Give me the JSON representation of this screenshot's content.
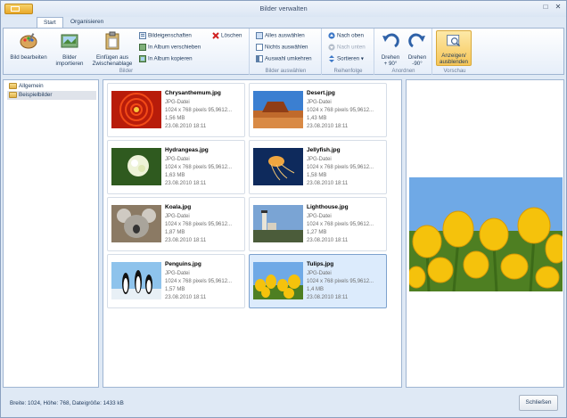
{
  "window": {
    "title": "Bilder verwalten"
  },
  "tabs": [
    "Start",
    "Organisieren"
  ],
  "ribbon": {
    "bilder": {
      "label": "Bilder",
      "bearbeiten": "Bild bearbeiten",
      "importieren_1": "Bilder",
      "importieren_2": "importieren",
      "einfuegen_1": "Einfügen aus",
      "einfuegen_2": "Zwischenablage",
      "eigenschaften": "Bildeigenschaften",
      "verschieben": "In Album verschieben",
      "kopieren": "In Album kopieren",
      "loeschen": "Löschen"
    },
    "auswahl": {
      "label": "Bilder auswählen",
      "alle": "Alles auswählen",
      "nichts": "Nichts auswählen",
      "umkehren": "Auswahl umkehren"
    },
    "reihenfolge": {
      "label": "Reihenfolge",
      "oben": "Nach oben",
      "unten": "Nach unten",
      "sortieren": "Sortieren ▾"
    },
    "anordnen": {
      "label": "Anordnen",
      "drehen_plus_1": "Drehen",
      "drehen_plus_2": "+ 90°",
      "drehen_minus_1": "Drehen",
      "drehen_minus_2": "-90°"
    },
    "vorschau": {
      "label": "Vorschau",
      "anzeigen_1": "Anzeigen/",
      "anzeigen_2": "ausblenden"
    }
  },
  "tree": [
    {
      "label": "Allgemein"
    },
    {
      "label": "Beispielbilder"
    }
  ],
  "images": [
    {
      "name": "Chrysanthemum.jpg",
      "type": "JPG-Datei",
      "dims": "1024 x 768 pixels 95,9612...",
      "size": "1,56 MB",
      "date": "23.08.2010 18:11"
    },
    {
      "name": "Desert.jpg",
      "type": "JPG-Datei",
      "dims": "1024 x 768 pixels 95,9612...",
      "size": "1,43 MB",
      "date": "23.08.2010 18:11"
    },
    {
      "name": "Hydrangeas.jpg",
      "type": "JPG-Datei",
      "dims": "1024 x 768 pixels 95,9612...",
      "size": "1,63 MB",
      "date": "23.08.2010 18:11"
    },
    {
      "name": "Jellyfish.jpg",
      "type": "JPG-Datei",
      "dims": "1024 x 768 pixels 95,9612...",
      "size": "1,58 MB",
      "date": "23.08.2010 18:11"
    },
    {
      "name": "Koala.jpg",
      "type": "JPG-Datei",
      "dims": "1024 x 768 pixels 95,9612...",
      "size": "1,87 MB",
      "date": "23.08.2010 18:11"
    },
    {
      "name": "Lighthouse.jpg",
      "type": "JPG-Datei",
      "dims": "1024 x 768 pixels 95,9612...",
      "size": "1,27 MB",
      "date": "23.08.2010 18:11"
    },
    {
      "name": "Penguins.jpg",
      "type": "JPG-Datei",
      "dims": "1024 x 768 pixels 95,9612...",
      "size": "1,57 MB",
      "date": "23.08.2010 18:11"
    },
    {
      "name": "Tulips.jpg",
      "type": "JPG-Datei",
      "dims": "1024 x 768 pixels 95,9612...",
      "size": "1,4 MB",
      "date": "23.08.2010 18:11"
    }
  ],
  "status": "Breite: 1024, Höhe: 768, Dateigröße: 1433 kB",
  "close_label": "Schließen",
  "colors": {
    "accent": "#4a79b8",
    "selection": "#dcebfc"
  }
}
